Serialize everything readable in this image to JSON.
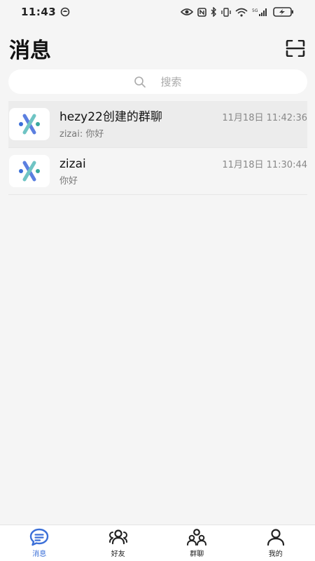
{
  "status_bar": {
    "time": "11:43"
  },
  "header": {
    "title": "消息"
  },
  "search": {
    "placeholder": "搜索"
  },
  "chats": [
    {
      "name": "hezy22创建的群聊",
      "preview": "zizai: 你好",
      "time": "11月18日 11:42:36"
    },
    {
      "name": "zizai",
      "preview": "你好",
      "time": "11月18日 11:30:44"
    }
  ],
  "tabs": [
    {
      "label": "消息",
      "icon": "message-icon",
      "active": true
    },
    {
      "label": "好友",
      "icon": "friends-icon",
      "active": false
    },
    {
      "label": "群聊",
      "icon": "group-chat-icon",
      "active": false
    },
    {
      "label": "我的",
      "icon": "profile-icon",
      "active": false
    }
  ],
  "colors": {
    "accent": "#3b6fd8",
    "background": "#f5f5f5"
  }
}
